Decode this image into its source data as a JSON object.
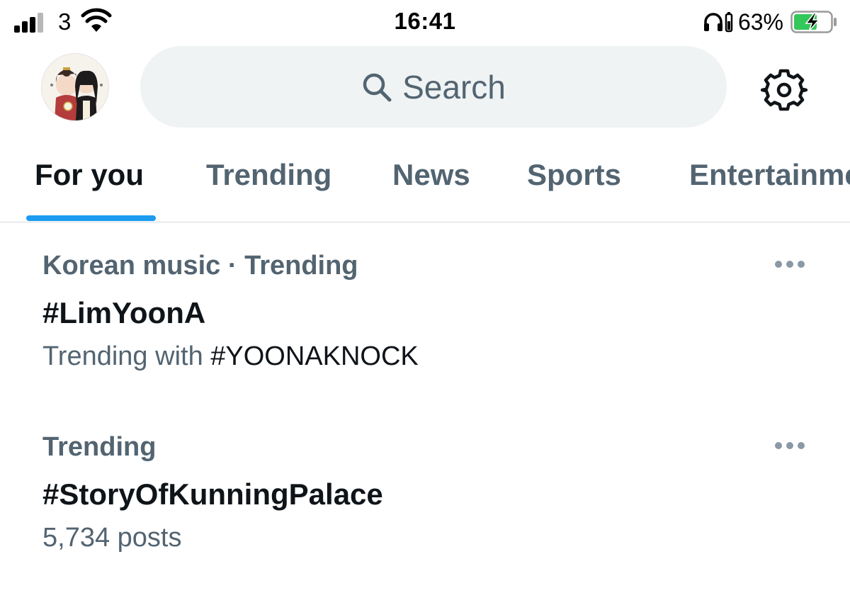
{
  "status_bar": {
    "carrier": "3",
    "time": "16:41",
    "battery_percent": "63%",
    "icons": [
      "signal-icon",
      "wifi-icon",
      "headphones-icon",
      "battery-charging-icon"
    ]
  },
  "header": {
    "search_placeholder": "Search",
    "icons": [
      "avatar",
      "search-icon",
      "settings-gear-icon"
    ]
  },
  "tabs": [
    {
      "label": "For you",
      "active": true
    },
    {
      "label": "Trending",
      "active": false
    },
    {
      "label": "News",
      "active": false
    },
    {
      "label": "Sports",
      "active": false
    },
    {
      "label": "Entertainment",
      "active": false
    }
  ],
  "trends": [
    {
      "context": "Korean music · Trending",
      "title": "#LimYoonA",
      "meta_prefix": "Trending with ",
      "meta_hashtag": "#YOONAKNOCK"
    },
    {
      "context": "Trending",
      "title": "#StoryOfKunningPalace",
      "meta_prefix": "5,734 posts"
    }
  ],
  "colors": {
    "accent": "#1d9bf0",
    "secondary_text": "#536471",
    "primary_text": "#0f1419",
    "search_background": "#eff3f4",
    "battery_fill": "#34c759"
  }
}
